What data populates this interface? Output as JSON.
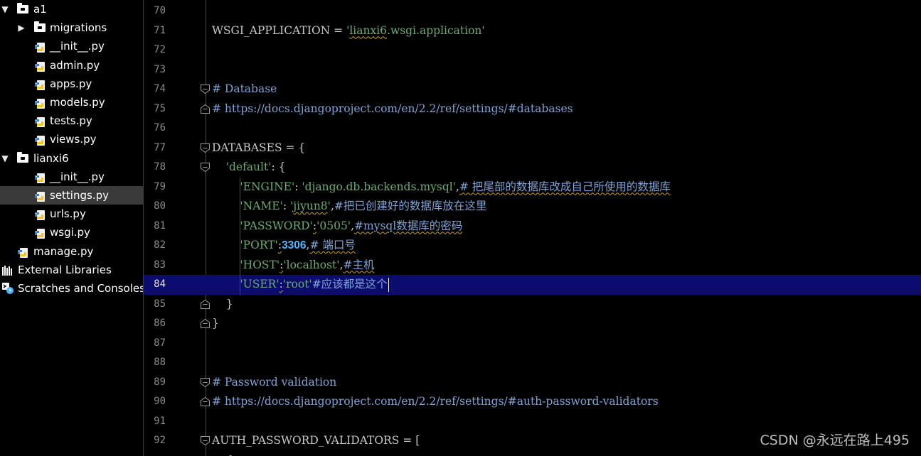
{
  "sidebar": {
    "items": [
      {
        "label": "a1",
        "type": "folder",
        "expanded": true,
        "level": 0
      },
      {
        "label": "migrations",
        "type": "folder",
        "expanded": false,
        "level": 1
      },
      {
        "label": "__init__.py",
        "type": "python-file",
        "level": 1
      },
      {
        "label": "admin.py",
        "type": "python-file",
        "level": 1
      },
      {
        "label": "apps.py",
        "type": "python-file",
        "level": 1
      },
      {
        "label": "models.py",
        "type": "python-file",
        "level": 1
      },
      {
        "label": "tests.py",
        "type": "python-file",
        "level": 1
      },
      {
        "label": "views.py",
        "type": "python-file",
        "level": 1
      },
      {
        "label": "lianxi6",
        "type": "folder",
        "expanded": true,
        "level": 0
      },
      {
        "label": "__init__.py",
        "type": "python-file",
        "level": 1
      },
      {
        "label": "settings.py",
        "type": "python-file",
        "level": 1,
        "selected": true
      },
      {
        "label": "urls.py",
        "type": "python-file",
        "level": 1
      },
      {
        "label": "wsgi.py",
        "type": "python-file",
        "level": 1
      },
      {
        "label": "manage.py",
        "type": "python-file",
        "level": 0
      },
      {
        "label": "External Libraries",
        "type": "libraries",
        "level": -1
      },
      {
        "label": "Scratches and Consoles",
        "type": "scratches",
        "level": -1
      }
    ]
  },
  "editor": {
    "current_line": 84,
    "lines": [
      {
        "num": "70",
        "tokens": []
      },
      {
        "num": "71",
        "tokens": [
          {
            "t": "WSGI_APPLICATION = ",
            "c": "plain"
          },
          {
            "t": "'",
            "c": "str"
          },
          {
            "t": "lianxi6",
            "c": "str squig"
          },
          {
            "t": ".wsgi.application'",
            "c": "str"
          }
        ]
      },
      {
        "num": "72",
        "tokens": []
      },
      {
        "num": "73",
        "tokens": []
      },
      {
        "num": "74",
        "tokens": [
          {
            "t": "# Database",
            "c": "com"
          }
        ]
      },
      {
        "num": "75",
        "tokens": [
          {
            "t": "# https://docs.djangoproject.com/en/2.2/ref/settings/#databases",
            "c": "com"
          }
        ]
      },
      {
        "num": "76",
        "tokens": []
      },
      {
        "num": "77",
        "tokens": [
          {
            "t": "DATABASES = {",
            "c": "plain"
          }
        ]
      },
      {
        "num": "78",
        "tokens": [
          {
            "t": "    ",
            "c": "plain"
          },
          {
            "t": "'default'",
            "c": "str"
          },
          {
            "t": ": {",
            "c": "plain"
          }
        ]
      },
      {
        "num": "79",
        "tokens": [
          {
            "t": "        ",
            "c": "plain"
          },
          {
            "t": "'ENGINE'",
            "c": "str"
          },
          {
            "t": ": ",
            "c": "plain"
          },
          {
            "t": "'django.db.backends.mysql'",
            "c": "str"
          },
          {
            "t": ",",
            "c": "plain"
          },
          {
            "t": "# 把尾部的数据库改成自己所使用的数据库",
            "c": "com squig"
          }
        ]
      },
      {
        "num": "80",
        "tokens": [
          {
            "t": "        ",
            "c": "plain"
          },
          {
            "t": "'NAME'",
            "c": "str"
          },
          {
            "t": ": ",
            "c": "plain"
          },
          {
            "t": "'",
            "c": "str"
          },
          {
            "t": "jiyun8",
            "c": "str squig"
          },
          {
            "t": "'",
            "c": "str"
          },
          {
            "t": ",",
            "c": "plain"
          },
          {
            "t": "#把已创建好的数据库放在这里",
            "c": "com"
          }
        ]
      },
      {
        "num": "81",
        "tokens": [
          {
            "t": "        ",
            "c": "plain"
          },
          {
            "t": "'PASSWORD'",
            "c": "str"
          },
          {
            "t": ":",
            "c": "plain squig"
          },
          {
            "t": "'0505'",
            "c": "str"
          },
          {
            "t": ",",
            "c": "plain"
          },
          {
            "t": "#mysql数据库的密码",
            "c": "com squig"
          }
        ]
      },
      {
        "num": "82",
        "tokens": [
          {
            "t": "        ",
            "c": "plain"
          },
          {
            "t": "'PORT'",
            "c": "str"
          },
          {
            "t": ":",
            "c": "plain squig"
          },
          {
            "t": "3306",
            "c": "num"
          },
          {
            "t": ",",
            "c": "plain"
          },
          {
            "t": "# 端口号",
            "c": "com squig"
          }
        ]
      },
      {
        "num": "83",
        "tokens": [
          {
            "t": "        ",
            "c": "plain"
          },
          {
            "t": "'HOST'",
            "c": "str"
          },
          {
            "t": ":",
            "c": "plain squig"
          },
          {
            "t": "'localhost'",
            "c": "str"
          },
          {
            "t": ",",
            "c": "plain"
          },
          {
            "t": "#主机",
            "c": "com squig"
          }
        ]
      },
      {
        "num": "84",
        "tokens": [
          {
            "t": "        ",
            "c": "plain"
          },
          {
            "t": "'USER'",
            "c": "str"
          },
          {
            "t": ":",
            "c": "plain squig"
          },
          {
            "t": "'root'",
            "c": "str"
          },
          {
            "t": "#应该都是这个",
            "c": "com"
          }
        ]
      },
      {
        "num": "85",
        "tokens": [
          {
            "t": "    }",
            "c": "plain"
          }
        ]
      },
      {
        "num": "86",
        "tokens": [
          {
            "t": "}",
            "c": "plain"
          }
        ]
      },
      {
        "num": "87",
        "tokens": []
      },
      {
        "num": "88",
        "tokens": []
      },
      {
        "num": "89",
        "tokens": [
          {
            "t": "# Password validation",
            "c": "com"
          }
        ]
      },
      {
        "num": "90",
        "tokens": [
          {
            "t": "# https://docs.djangoproject.com/en/2.2/ref/settings/#auth-password-validators",
            "c": "com"
          }
        ]
      },
      {
        "num": "91",
        "tokens": []
      },
      {
        "num": "92",
        "tokens": [
          {
            "t": "AUTH_PASSWORD_VALIDATORS = [",
            "c": "plain"
          }
        ]
      },
      {
        "num": "",
        "tokens": [
          {
            "t": "    {",
            "c": "plain"
          }
        ]
      }
    ],
    "colors": {
      "current_line_bg": "#0c0c6e",
      "string": "#6aab73",
      "comment": "#7ea3d6",
      "number": "#4fb3ff"
    }
  },
  "watermark": "CSDN @永远在路上495"
}
